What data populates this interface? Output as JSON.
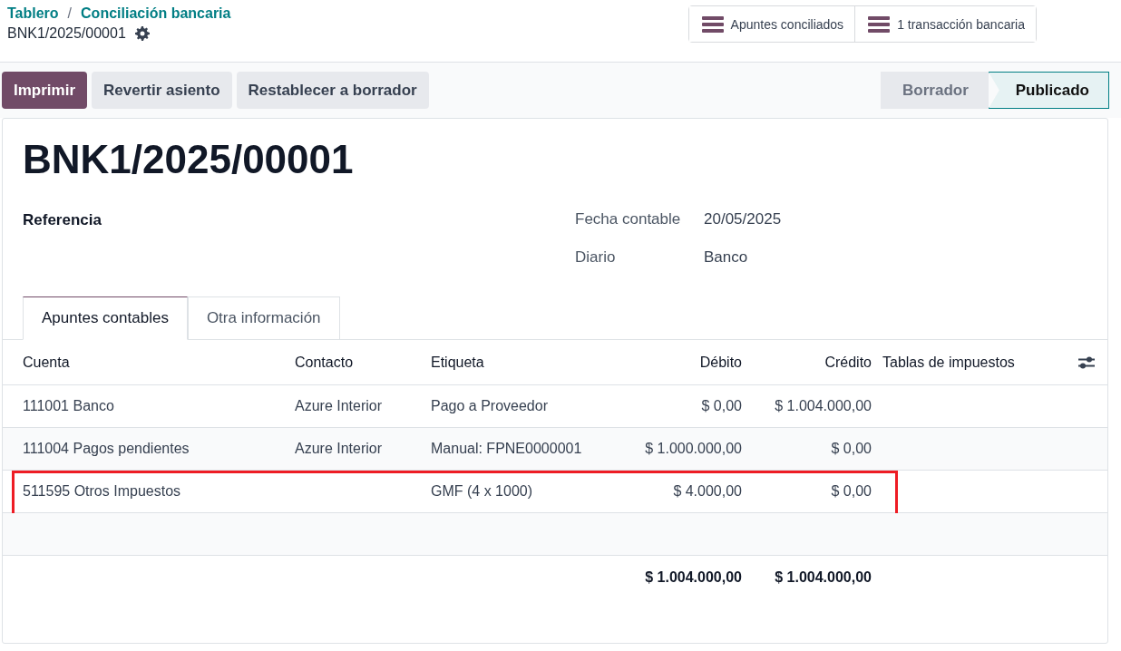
{
  "breadcrumb": {
    "items": [
      "Tablero",
      "Conciliación bancaria"
    ],
    "separator": "/",
    "current": "BNK1/2025/00001"
  },
  "smart_buttons": [
    "Apuntes conciliados",
    "1 transacción bancaria"
  ],
  "actions": [
    {
      "label": "Imprimir",
      "kind": "primary"
    },
    {
      "label": "Revertir asiento",
      "kind": "secondary"
    },
    {
      "label": "Restablecer a borrador",
      "kind": "secondary"
    }
  ],
  "status_bar": [
    {
      "label": "Borrador",
      "selected": false
    },
    {
      "label": "Publicado",
      "selected": true
    }
  ],
  "record": {
    "title": "BNK1/2025/00001",
    "reference_label": "Referencia",
    "fields": [
      {
        "label": "Fecha contable",
        "value": "20/05/2025"
      },
      {
        "label": "Diario",
        "value": "Banco"
      }
    ]
  },
  "tabs": [
    {
      "label": "Apuntes contables",
      "selected": true
    },
    {
      "label": "Otra información",
      "selected": false
    }
  ],
  "table": {
    "columns": [
      "Cuenta",
      "Contacto",
      "Etiqueta",
      "Débito",
      "Crédito",
      "Tablas de impuestos"
    ],
    "rows": [
      {
        "cells": [
          "111001 Banco",
          "Azure Interior",
          "Pago a Proveedor",
          "$ 0,00",
          "$ 1.004.000,00",
          ""
        ],
        "highlighted": false
      },
      {
        "cells": [
          "111004 Pagos pendientes",
          "Azure Interior",
          "Manual: FPNE0000001",
          "$ 1.000.000,00",
          "$ 0,00",
          ""
        ],
        "highlighted": false
      },
      {
        "cells": [
          "511595 Otros Impuestos",
          "",
          "GMF (4 x 1000)",
          "$ 4.000,00",
          "$ 0,00",
          ""
        ],
        "highlighted": true
      }
    ],
    "totals": [
      "$ 1.004.000,00",
      "$ 1.004.000,00"
    ]
  }
}
